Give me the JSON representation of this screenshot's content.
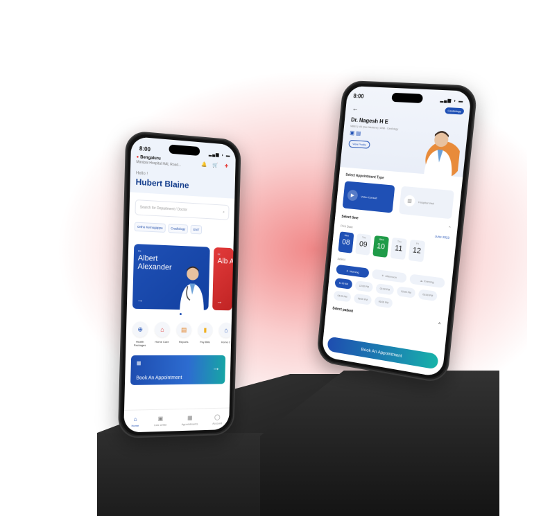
{
  "left_phone": {
    "status_time": "8:00",
    "location_city": "Bengaluru",
    "location_address": "Manipal Hospital HAL Road...",
    "greeting": "Hello !",
    "user_name": "Hubert Blaine",
    "search_placeholder": "Search for Department / Doctor",
    "chips": [
      "Ortho Kemugappa",
      "Cradiology",
      "ENT"
    ],
    "doctor_cards": [
      {
        "prefix": "Dr.",
        "name": "Albert Alexander",
        "color": "#1f50b5"
      },
      {
        "prefix": "Dr.",
        "name": "Alb Ale",
        "color": "#e23a3a"
      }
    ],
    "services": [
      {
        "icon": "health-packages-icon",
        "label": "Health Packages"
      },
      {
        "icon": "home-care-icon",
        "label": "Home Care"
      },
      {
        "icon": "reports-icon",
        "label": "Reports"
      },
      {
        "icon": "pay-bills-icon",
        "label": "Pay Bills"
      },
      {
        "icon": "home-icon",
        "label": "Home C"
      }
    ],
    "banner_label": "Book An Appointment",
    "tabs": [
      {
        "icon": "home-icon",
        "label": "Home"
      },
      {
        "icon": "uhid-icon",
        "label": "Link UHID"
      },
      {
        "icon": "calendar-icon",
        "label": "Appointments"
      },
      {
        "icon": "user-icon",
        "label": "Account"
      }
    ]
  },
  "right_phone": {
    "status_time": "8:00",
    "specialty_badge": "Cardiology",
    "doctor_name": "Dr. Nagesh H E",
    "doctor_quals": "MBBS | MD (Gen Medicine) | DNB - Cardiology",
    "view_profile": "View Profile",
    "section_title": "Select Appointment Type",
    "appointment_types": [
      {
        "label": "Video Consult",
        "active": true
      },
      {
        "label": "Hospital Visit",
        "active": false
      }
    ],
    "select_time": "Select time",
    "pick_date": "Pick Date",
    "month": "June 2023",
    "dates": [
      {
        "day": "Mon",
        "num": "08",
        "state": "blue"
      },
      {
        "day": "Tue",
        "num": "09",
        "state": "off"
      },
      {
        "day": "Wed",
        "num": "10",
        "state": "green"
      },
      {
        "day": "Thu",
        "num": "11",
        "state": "off"
      },
      {
        "day": "Fri",
        "num": "12",
        "state": "off"
      }
    ],
    "select_label": "Select",
    "shifts": [
      {
        "label": "Morning",
        "active": true
      },
      {
        "label": "Afternoon",
        "active": false
      },
      {
        "label": "Evening",
        "active": false
      }
    ],
    "slots": [
      {
        "label": "11:00 AM",
        "active": true
      },
      {
        "label": "12:00 PM",
        "active": false
      },
      {
        "label": "01:00 PM",
        "active": false
      },
      {
        "label": "02:00 PM",
        "active": false
      },
      {
        "label": "03:00 PM",
        "active": false
      },
      {
        "label": "04:00 PM",
        "active": false
      },
      {
        "label": "05:00 PM",
        "active": false
      },
      {
        "label": "06:00 PM",
        "active": false
      }
    ],
    "select_patient": "Select patient",
    "cta": "Book An Appointment"
  }
}
